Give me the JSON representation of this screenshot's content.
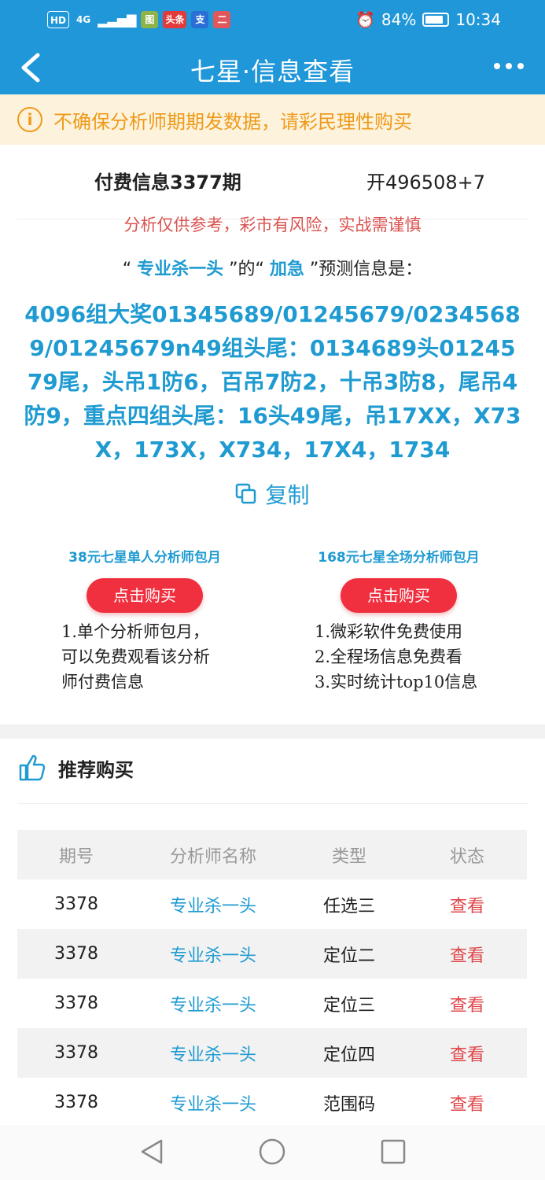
{
  "status": {
    "left_badges": [
      "HD",
      "4G",
      "图",
      "头条",
      "支",
      "二"
    ],
    "alarm": "⏰",
    "battery": "84%",
    "time": "10:34"
  },
  "nav": {
    "title": "七星·信息查看"
  },
  "notice": {
    "text": "不确保分析师期期发数据，请彩民理性购买"
  },
  "info": {
    "period": "付费信息3377期",
    "open": "开496508+7",
    "risk": "分析仅供参考，彩市有风险，实战需谨慎",
    "head_pre": "“ ",
    "analyst": "专业杀一头",
    "head_mid": " ”的“ ",
    "type": "加急",
    "head_post": " ”预测信息是：",
    "prediction": "4096组大奖01345689/01245679/02345689/01245679n49组头尾：0134689头0124579尾，头吊1防6，百吊7防2，十吊3防8，尾吊4防9，重点四组头尾：16头49尾，吊17XX，X73X，173X，X734，17X4，1734",
    "copy": "复制"
  },
  "plans": [
    {
      "title": "38元七星单人分析师包月",
      "button": "点击购买",
      "lines": [
        "1.单个分析师包月，",
        "可以免费观看该分析",
        "师付费信息"
      ]
    },
    {
      "title": "168元七星全场分析师包月",
      "button": "点击购买",
      "lines": [
        "1.微彩软件免费使用",
        "2.全程场信息免费看",
        "3.实时统计top10信息"
      ]
    }
  ],
  "recommend": {
    "title": "推荐购买",
    "headers": [
      "期号",
      "分析师名称",
      "类型",
      "状态"
    ],
    "rows": [
      {
        "issue": "3378",
        "analyst": "专业杀一头",
        "type": "任选三",
        "status": "查看"
      },
      {
        "issue": "3378",
        "analyst": "专业杀一头",
        "type": "定位二",
        "status": "查看"
      },
      {
        "issue": "3378",
        "analyst": "专业杀一头",
        "type": "定位三",
        "status": "查看"
      },
      {
        "issue": "3378",
        "analyst": "专业杀一头",
        "type": "定位四",
        "status": "查看"
      },
      {
        "issue": "3378",
        "analyst": "专业杀一头",
        "type": "范围码",
        "status": "查看"
      }
    ]
  },
  "colors": {
    "brand": "#1f97d8",
    "accent_red": "#f02f3f",
    "warning": "#ee9a1a"
  }
}
